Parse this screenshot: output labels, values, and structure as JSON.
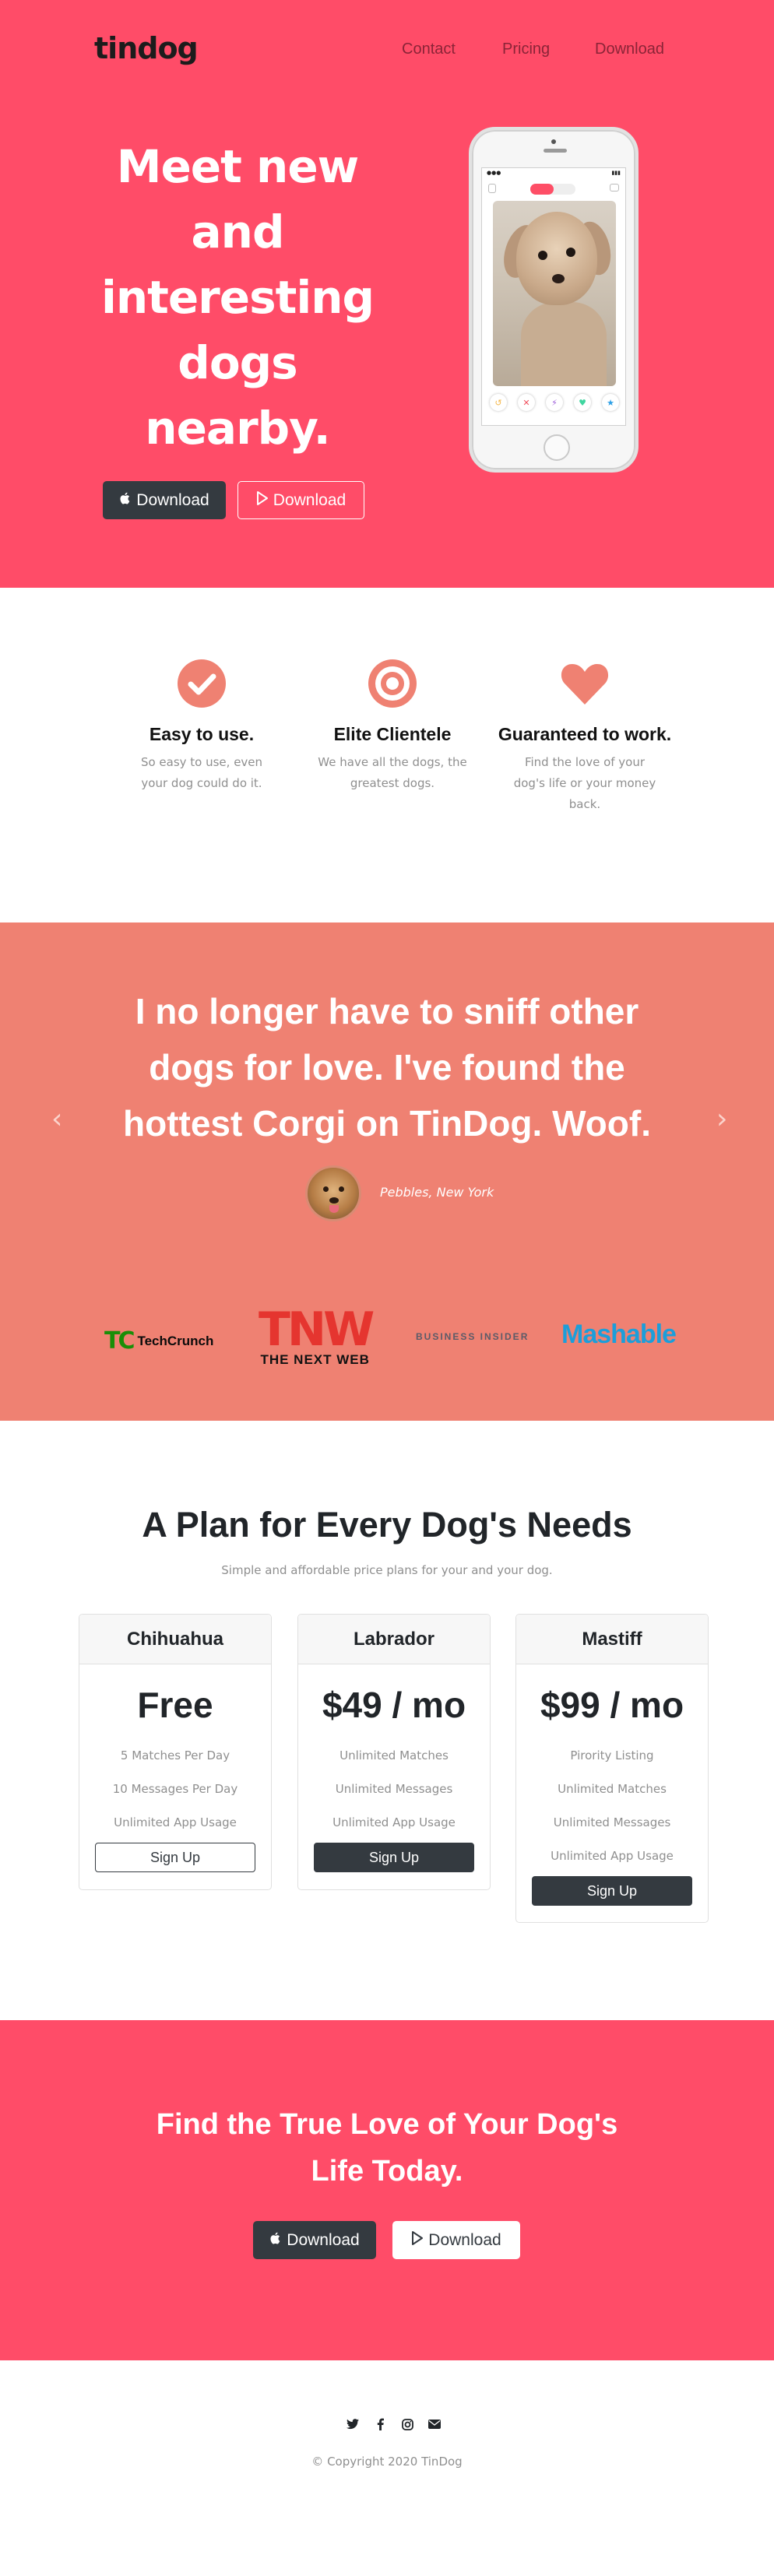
{
  "header": {
    "brand": "tindog",
    "nav": {
      "contact": "Contact",
      "pricing": "Pricing",
      "download": "Download"
    }
  },
  "hero": {
    "title": "Meet new and interesting dogs nearby.",
    "apple_button": "Download",
    "play_button": "Download"
  },
  "features": [
    {
      "icon": "check-circle-icon",
      "title": "Easy to use.",
      "text": "So easy to use, even your dog could do it."
    },
    {
      "icon": "bullseye-icon",
      "title": "Elite Clientele",
      "text": "We have all the dogs, the greatest dogs."
    },
    {
      "icon": "heart-icon",
      "title": "Guaranteed to work.",
      "text": "Find the love of your dog's life or your money back."
    }
  ],
  "testimonial": {
    "quote": "I no longer have to sniff other dogs for love. I've found the hottest Corgi on TinDog. Woof.",
    "author": "Pebbles, New York"
  },
  "press": {
    "techcrunch": "TechCrunch",
    "tnw_logo": "TNW",
    "tnw_name": "THE NEXT WEB",
    "business_insider": "BUSINESS INSIDER",
    "mashable": "Mashable"
  },
  "pricing": {
    "title": "A Plan for Every Dog's Needs",
    "subtitle": "Simple and affordable price plans for your and your dog.",
    "plans": [
      {
        "name": "Chihuahua",
        "price": "Free",
        "features": [
          "5 Matches Per Day",
          "10 Messages Per Day",
          "Unlimited App Usage"
        ],
        "button": "Sign Up"
      },
      {
        "name": "Labrador",
        "price": "$49 / mo",
        "features": [
          "Unlimited Matches",
          "Unlimited Messages",
          "Unlimited App Usage"
        ],
        "button": "Sign Up"
      },
      {
        "name": "Mastiff",
        "price": "$99 / mo",
        "features": [
          "Pirority Listing",
          "Unlimited Matches",
          "Unlimited Messages",
          "Unlimited App Usage"
        ],
        "button": "Sign Up"
      }
    ]
  },
  "cta": {
    "title": "Find the True Love of Your Dog's Life Today.",
    "apple_button": "Download",
    "play_button": "Download"
  },
  "footer": {
    "copyright": "© Copyright 2020 TinDog",
    "social_icons": [
      "twitter-icon",
      "facebook-icon",
      "instagram-icon",
      "envelope-icon"
    ]
  },
  "colors": {
    "primary": "#ff4c68",
    "testimonial_bg": "#ef8172",
    "feature_icon": "#ef8172",
    "dark": "#343a40"
  }
}
